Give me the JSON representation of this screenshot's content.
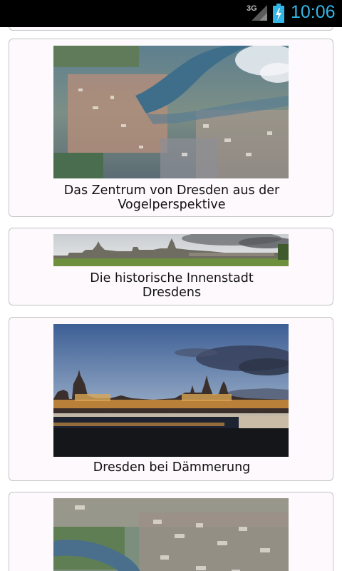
{
  "status_bar": {
    "network": "3G",
    "time": "10:06",
    "colors": {
      "accent": "#33b5e5",
      "background": "#000000"
    },
    "icons": [
      "signal-icon",
      "battery-charging-icon"
    ]
  },
  "gallery": {
    "items": [
      {
        "caption_lines": [
          "Das Zentrum von Dresden aus der",
          "Vogelperspektive"
        ],
        "image": "aerial-city-river-photo"
      },
      {
        "caption_lines": [
          "Die historische Innenstadt",
          "Dresdens"
        ],
        "image": "historic-skyline-panorama-photo"
      },
      {
        "caption_lines": [
          "Dresden bei Dämmerung"
        ],
        "image": "dresden-dusk-skyline-photo"
      },
      {
        "caption_lines": [],
        "image": "aerial-river-districts-photo"
      }
    ]
  }
}
